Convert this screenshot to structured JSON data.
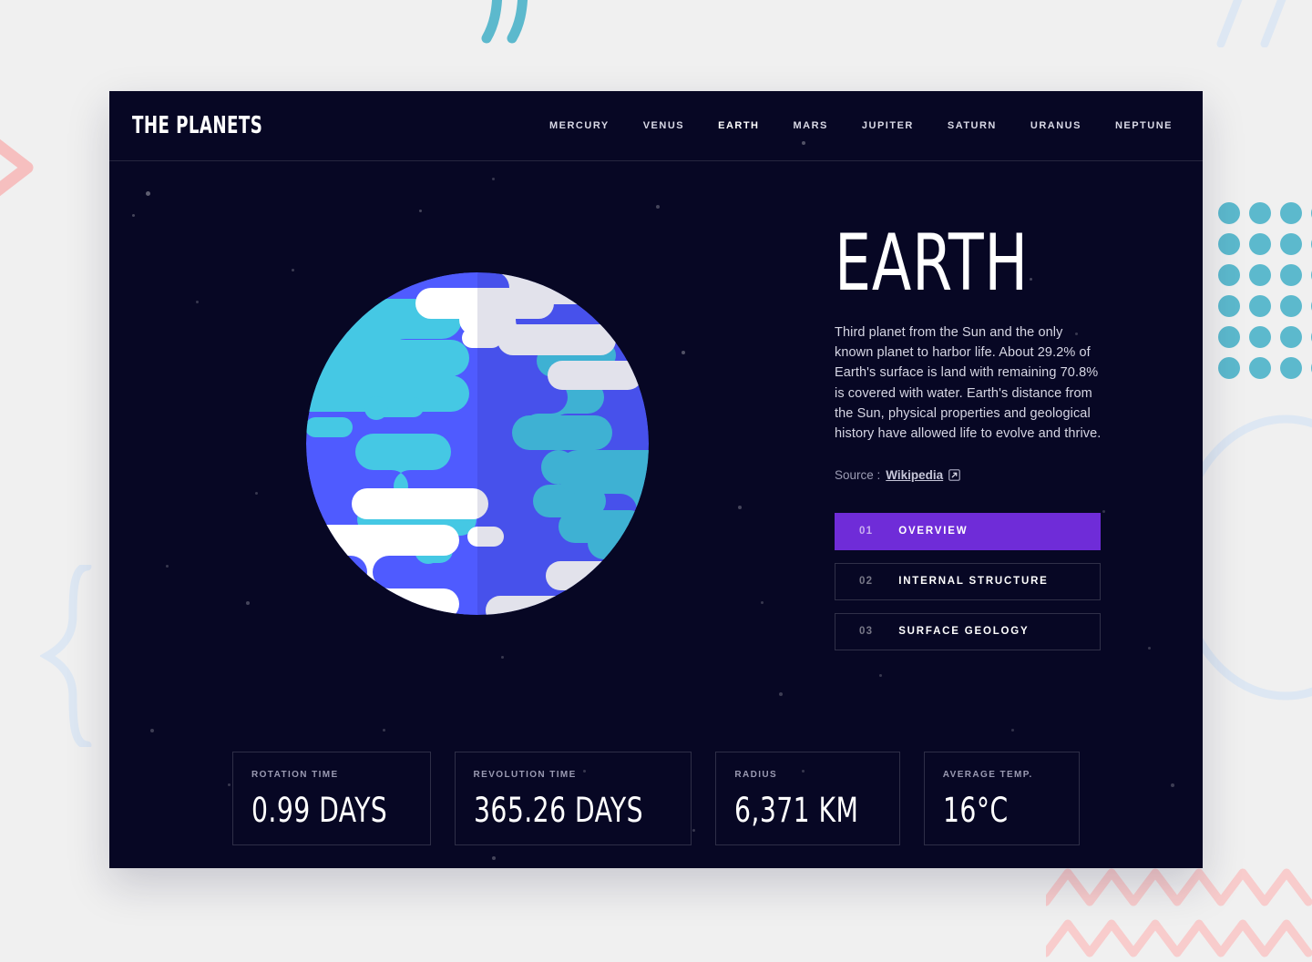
{
  "decorations": {
    "quotes_icon": "quotation-marks",
    "slashes_icon": "diagonal-slashes",
    "chevron_icon": "chevron-right",
    "brace_icon": "curly-brace",
    "ellipse_icon": "ellipse-outline",
    "dots_icon": "dot-grid",
    "zigzag_icon": "zigzag-lines",
    "teal": "#5cb9cd",
    "pink": "#f6c2c2",
    "pale_blue": "#dde7f3"
  },
  "header": {
    "logo": "THE PLANETS",
    "nav": [
      {
        "label": "MERCURY",
        "active": false
      },
      {
        "label": "VENUS",
        "active": false
      },
      {
        "label": "EARTH",
        "active": true
      },
      {
        "label": "MARS",
        "active": false
      },
      {
        "label": "JUPITER",
        "active": false
      },
      {
        "label": "SATURN",
        "active": false
      },
      {
        "label": "URANUS",
        "active": false
      },
      {
        "label": "NEPTUNE",
        "active": false
      }
    ]
  },
  "planet": {
    "name": "earth-illustration",
    "base_color": "#4f5bff",
    "shadow_color": "#4a54e8",
    "land_color": "#45c8e4",
    "cloud_color": "#ffffff",
    "cloud_shadow_color": "#e8e8ef"
  },
  "main": {
    "title": "EARTH",
    "description": "Third planet from the Sun and the only known planet to harbor life. About 29.2% of Earth's surface is land with remaining 70.8% is covered with water. Earth's distance from the Sun, physical properties and geological history have allowed life to evolve and thrive.",
    "source_label": "Source :",
    "source_link": "Wikipedia",
    "external_link_icon": "external-link-icon",
    "accent_color": "#6f2cd8",
    "tabs": [
      {
        "number": "01",
        "label": "OVERVIEW",
        "active": true
      },
      {
        "number": "02",
        "label": "INTERNAL STRUCTURE",
        "active": false
      },
      {
        "number": "03",
        "label": "SURFACE GEOLOGY",
        "active": false
      }
    ]
  },
  "stats": [
    {
      "label": "ROTATION TIME",
      "value": "0.99 DAYS"
    },
    {
      "label": "REVOLUTION TIME",
      "value": "365.26 DAYS"
    },
    {
      "label": "RADIUS",
      "value": "6,371 KM"
    },
    {
      "label": "AVERAGE TEMP.",
      "value": "16°C"
    }
  ]
}
